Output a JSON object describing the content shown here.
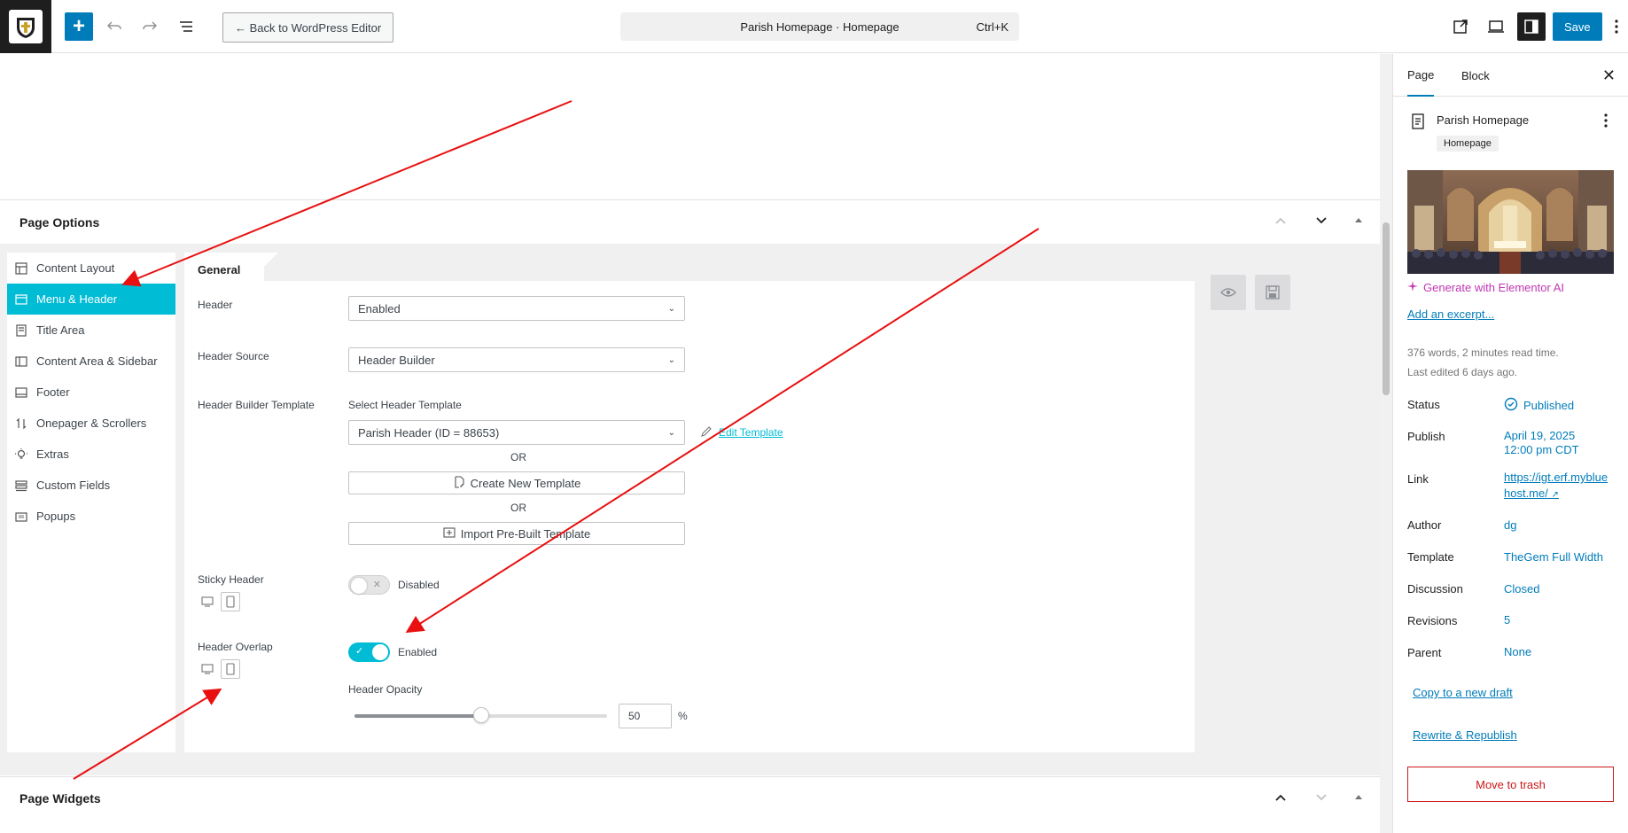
{
  "topbar": {
    "back_label": "← Back to WordPress Editor",
    "doc_title": "Parish Homepage · Homepage",
    "shortcut": "Ctrl+K",
    "save_label": "Save"
  },
  "page_options": {
    "title": "Page Options",
    "nav": [
      {
        "label": "Content Layout",
        "icon": "layout-icon"
      },
      {
        "label": "Menu & Header",
        "icon": "header-icon",
        "active": true
      },
      {
        "label": "Title Area",
        "icon": "title-icon"
      },
      {
        "label": "Content Area & Sidebar",
        "icon": "sidebar-icon"
      },
      {
        "label": "Footer",
        "icon": "footer-icon"
      },
      {
        "label": "Onepager & Scrollers",
        "icon": "scroll-icon"
      },
      {
        "label": "Extras",
        "icon": "bulb-icon"
      },
      {
        "label": "Custom Fields",
        "icon": "fields-icon"
      },
      {
        "label": "Popups",
        "icon": "popup-icon"
      }
    ],
    "tab_general": "General",
    "fields": {
      "header_label": "Header",
      "header_value": "Enabled",
      "header_source_label": "Header Source",
      "header_source_value": "Header Builder",
      "builder_template_label": "Header Builder Template",
      "select_template_label": "Select Header Template",
      "template_value": "Parish Header (ID = 88653)",
      "edit_template": "Edit Template",
      "or_1": "OR",
      "create_template": "Create New Template",
      "or_2": "OR",
      "import_template": "Import Pre-Built Template",
      "sticky_label": "Sticky Header",
      "sticky_state": "Disabled",
      "overlap_label": "Header Overlap",
      "overlap_state": "Enabled",
      "opacity_label": "Header Opacity",
      "opacity_value": "50",
      "opacity_unit": "%"
    }
  },
  "page_widgets": {
    "title": "Page Widgets"
  },
  "sidebar": {
    "tab_page": "Page",
    "tab_block": "Block",
    "page_title": "Parish Homepage",
    "page_chip": "Homepage",
    "ai_label": "Generate with Elementor AI",
    "excerpt_link": "Add an excerpt...",
    "meta_line1": "376 words, 2 minutes read time.",
    "meta_line2": "Last edited 6 days ago.",
    "rows": {
      "status_label": "Status",
      "status_value": "Published",
      "publish_label": "Publish",
      "publish_value_1": "April 19, 2025",
      "publish_value_2": "12:00 pm CDT",
      "link_label": "Link",
      "link_value_1": "https://igt.erf.myblue",
      "link_value_2": "host.me/",
      "author_label": "Author",
      "author_value": "dg",
      "template_label": "Template",
      "template_value": "TheGem Full Width",
      "discussion_label": "Discussion",
      "discussion_value": "Closed",
      "revisions_label": "Revisions",
      "revisions_value": "5",
      "parent_label": "Parent",
      "parent_value": "None"
    },
    "copy_draft": "Copy to a new draft",
    "rewrite": "Rewrite & Republish",
    "trash": "Move to trash"
  },
  "colors": {
    "accent": "#007cba",
    "cyan": "#00bcd4",
    "annotation": "#e81010"
  },
  "toggles": {
    "sticky_header_on": false,
    "header_overlap_on": true
  },
  "slider_fraction": 0.5
}
